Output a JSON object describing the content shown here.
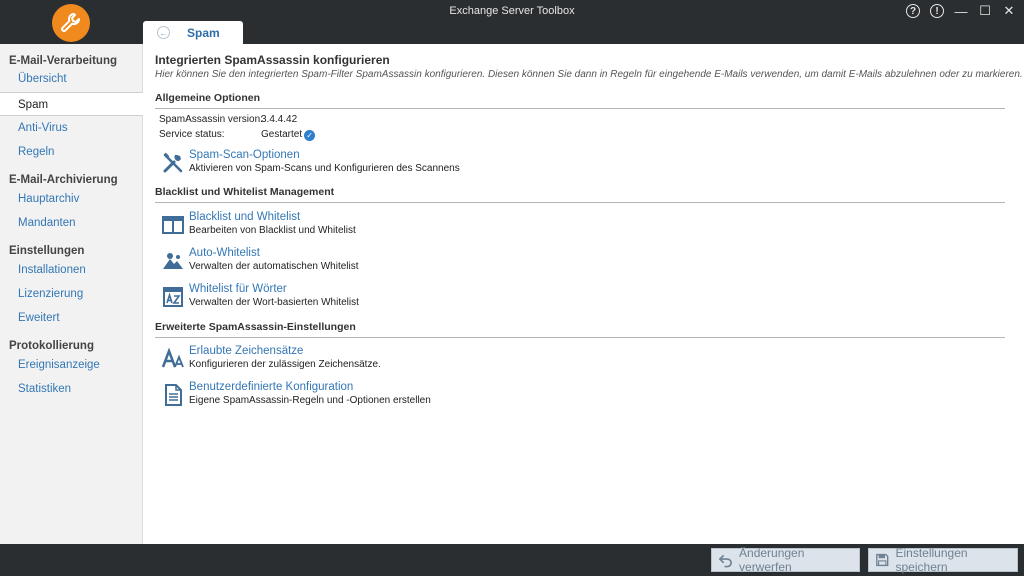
{
  "window": {
    "title": "Exchange Server Toolbox"
  },
  "tab": {
    "label": "Spam"
  },
  "sidebar": {
    "groups": [
      {
        "label": "E-Mail-Verarbeitung",
        "items": [
          "Übersicht",
          "Spam",
          "Anti-Virus",
          "Regeln"
        ]
      },
      {
        "label": "E-Mail-Archivierung",
        "items": [
          "Hauptarchiv",
          "Mandanten"
        ]
      },
      {
        "label": "Einstellungen",
        "items": [
          "Installationen",
          "Lizenzierung",
          "Eweitert"
        ]
      },
      {
        "label": "Protokollierung",
        "items": [
          "Ereignisanzeige",
          "Statistiken"
        ]
      }
    ],
    "active": "Spam"
  },
  "main": {
    "title": "Integrierten SpamAssassin konfigurieren",
    "description": "Hier können Sie den integrierten Spam-Filter SpamAssassin konfigurieren. Diesen können Sie dann in Regeln für eingehende E-Mails verwenden, um damit E-Mails abzulehnen oder zu markieren.",
    "sections": [
      {
        "title": "Allgemeine Optionen"
      },
      {
        "title": "Blacklist und Whitelist Management"
      },
      {
        "title": "Erweiterte SpamAssassin-Einstellungen"
      }
    ],
    "info": [
      {
        "key": "SpamAssassin version:",
        "value": "3.4.4.42"
      },
      {
        "key": "Service status:",
        "value": "Gestartet"
      }
    ],
    "actions": {
      "spam_scan": {
        "title": "Spam-Scan-Optionen",
        "desc": "Aktivieren von Spam-Scans und Konfigurieren des Scannens",
        "icon": "tools-icon"
      },
      "blacklist": {
        "title": "Blacklist und Whitelist",
        "desc": "Bearbeiten von Blacklist und Whitelist",
        "icon": "columns-icon"
      },
      "auto_whitelist": {
        "title": "Auto-Whitelist",
        "desc": "Verwalten der automatischen Whitelist",
        "icon": "auto-whitelist-icon"
      },
      "word_whitelist": {
        "title": "Whitelist für Wörter",
        "desc": "Verwalten der Wort-basierten Whitelist",
        "icon": "az-icon"
      },
      "charsets": {
        "title": "Erlaubte Zeichensätze",
        "desc": "Konfigurieren der zulässigen Zeichensätze.",
        "icon": "font-icon"
      },
      "custom_config": {
        "title": "Benutzerdefinierte Konfiguration",
        "desc": "Eigene SpamAssassin-Regeln und -Optionen erstellen",
        "icon": "document-icon"
      }
    }
  },
  "footer": {
    "discard_label": "Änderungen verwerfen",
    "save_label": "Einstellungen speichern"
  },
  "colors": {
    "accent": "#3377b5",
    "logo": "#f08a1e",
    "chrome": "#2b2e30"
  }
}
